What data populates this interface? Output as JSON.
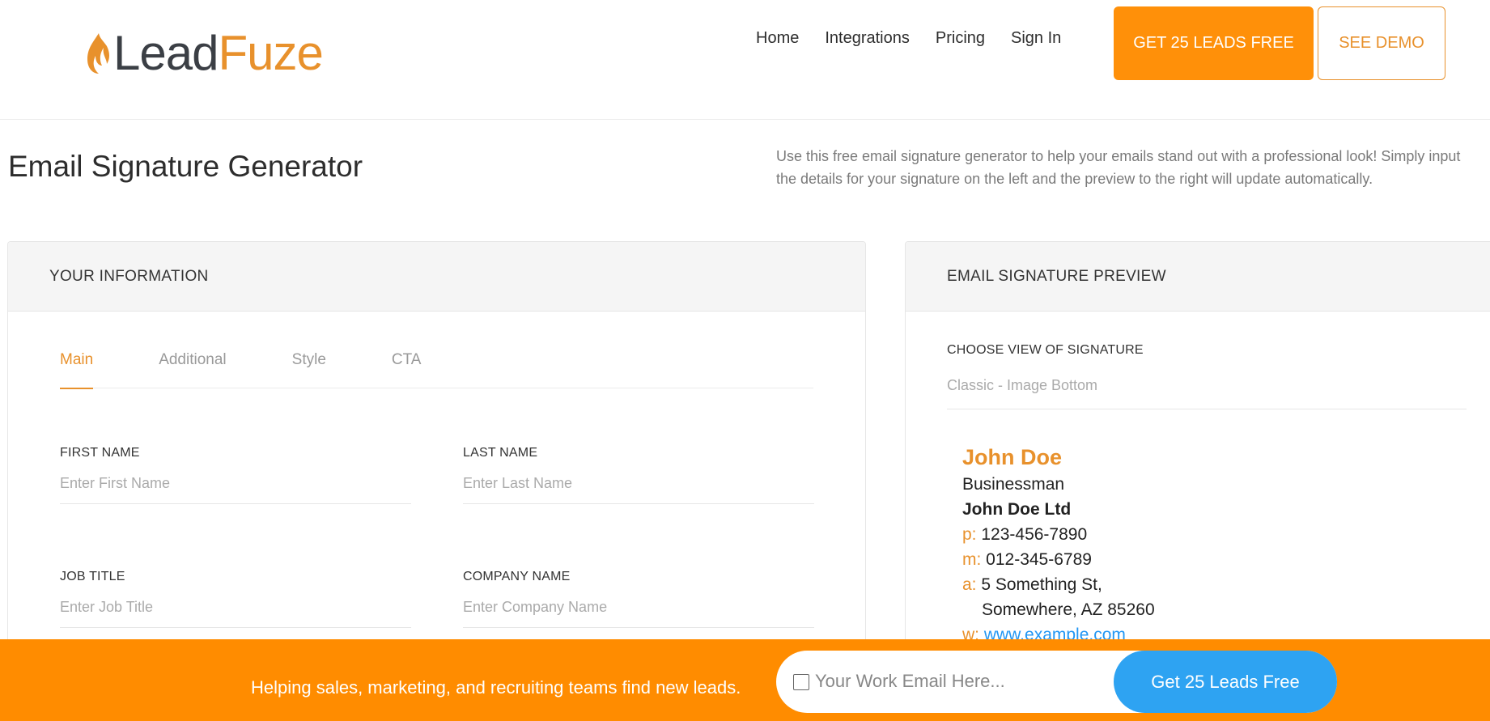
{
  "header": {
    "logo": {
      "part1": "Lead",
      "part2": "Fuze"
    },
    "nav": [
      {
        "label": "Home"
      },
      {
        "label": "Integrations"
      },
      {
        "label": "Pricing"
      },
      {
        "label": "Sign In"
      }
    ],
    "cta_primary": "GET 25 LEADS FREE",
    "cta_secondary": "SEE DEMO"
  },
  "page": {
    "title": "Email Signature Generator",
    "intro_line1": "Use this free email signature generator to help your emails stand out with a professional look! Simply input",
    "intro_line2": "the details for your signature on the left and the preview to the right will update automatically."
  },
  "left_panel": {
    "title": "YOUR INFORMATION",
    "tabs": [
      {
        "label": "Main",
        "active": true
      },
      {
        "label": "Additional",
        "active": false
      },
      {
        "label": "Style",
        "active": false
      },
      {
        "label": "CTA",
        "active": false
      }
    ],
    "fields": {
      "first_name": {
        "label": "FIRST NAME",
        "placeholder": "Enter First Name",
        "value": ""
      },
      "last_name": {
        "label": "LAST NAME",
        "placeholder": "Enter Last Name",
        "value": ""
      },
      "job_title": {
        "label": "JOB TITLE",
        "placeholder": "Enter Job Title",
        "value": ""
      },
      "company_name": {
        "label": "COMPANY NAME",
        "placeholder": "Enter Company Name",
        "value": ""
      }
    }
  },
  "right_panel": {
    "title": "EMAIL SIGNATURE PREVIEW",
    "choose_label": "CHOOSE VIEW OF SIGNATURE",
    "view_selected": "Classic - Image Bottom",
    "signature": {
      "name": "John Doe",
      "title": "Businessman",
      "company": "John Doe Ltd",
      "phone_key": "p:",
      "phone": "123-456-7890",
      "mobile_key": "m:",
      "mobile": "012-345-6789",
      "address_key": "a:",
      "address_line1": "5 Something St,",
      "address_line2": "Somewhere, AZ 85260",
      "web_key": "w:",
      "web": "www.example.com"
    }
  },
  "bottom_bar": {
    "text": "Helping sales, marketing, and recruiting teams find new leads.",
    "email_placeholder": "Your Work Email Here...",
    "button": "Get 25 Leads Free"
  },
  "colors": {
    "accent_orange": "#ff9009",
    "brand_orange": "#e8912c",
    "bar_orange": "#ff8c00",
    "button_blue": "#2ea3f2",
    "link_blue": "#2196f3"
  }
}
